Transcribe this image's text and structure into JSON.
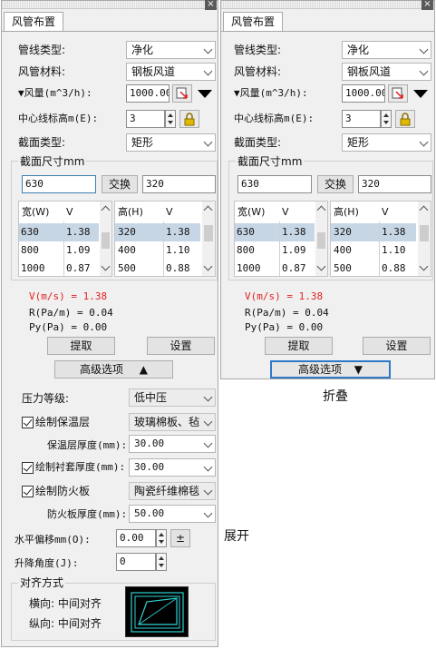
{
  "left": {
    "title_tab": "风管布置",
    "close": "×",
    "fields": {
      "duct_line_type_label": "管线类型:",
      "duct_line_type_value": "净化",
      "duct_material_label": "风管材料:",
      "duct_material_value": "钢板风道",
      "airflow_label": "▼风量(m^3/h):",
      "airflow_value": "1000.00",
      "center_elev_label": "中心线标高m(E):",
      "center_elev_value": "3",
      "section_type_label": "截面类型:",
      "section_type_value": "矩形"
    },
    "section": {
      "group_label": "截面尺寸mm",
      "width_value": "630",
      "swap_label": "交换",
      "height_value": "320",
      "w_header": "宽(W)",
      "v_header": "V",
      "h_header": "高(H)",
      "v2_header": "V",
      "w_rows": [
        {
          "w": "630",
          "v": "1.38"
        },
        {
          "w": "800",
          "v": "1.09"
        },
        {
          "w": "1000",
          "v": "0.87"
        }
      ],
      "h_rows": [
        {
          "h": "320",
          "v": "1.38"
        },
        {
          "h": "400",
          "v": "1.10"
        },
        {
          "h": "500",
          "v": "0.88"
        }
      ]
    },
    "results": {
      "velocity": "V(m/s) = 1.38",
      "resistance": "R(Pa/m) = 0.04",
      "pressure": "Py(Pa) = 0.00"
    },
    "extract_label": "提取",
    "settings_label": "设置",
    "advanced_label": "高级选项",
    "advanced_arrow": "▲",
    "pressure_level_label": "压力等级:",
    "pressure_level_value": "低中压",
    "insulation_label": "绘制保温层",
    "insulation_value": "玻璃棉板、毡",
    "insulation_thk_label": "保温层厚度(mm):",
    "insulation_thk_value": "30.00",
    "lining_label": "绘制衬套厚度(mm):",
    "lining_value": "30.00",
    "fireboard_label": "绘制防火板",
    "fireboard_value": "陶瓷纤维棉毯",
    "fireboard_thk_label": "防火板厚度(mm):",
    "fireboard_thk_value": "50.00",
    "h_offset_label": "水平偏移mm(O):",
    "h_offset_value": "0.00",
    "pm_label": "±",
    "lift_angle_label": "升降角度(J):",
    "lift_angle_value": "0",
    "align_group_label": "对齐方式",
    "align_h": "横向: 中间对齐",
    "align_v": "纵向: 中间对齐"
  },
  "right": {
    "title_tab": "风管布置",
    "close": "×",
    "fields": {
      "duct_line_type_label": "管线类型:",
      "duct_line_type_value": "净化",
      "duct_material_label": "风管材料:",
      "duct_material_value": "钢板风道",
      "airflow_label": "▼风量(m^3/h):",
      "airflow_value": "1000.00",
      "center_elev_label": "中心线标高m(E):",
      "center_elev_value": "3",
      "section_type_label": "截面类型:",
      "section_type_value": "矩形"
    },
    "section": {
      "group_label": "截面尺寸mm",
      "width_value": "630",
      "swap_label": "交换",
      "height_value": "320",
      "w_header": "宽(W)",
      "v_header": "V",
      "h_header": "高(H)",
      "v2_header": "V",
      "w_rows": [
        {
          "w": "630",
          "v": "1.38"
        },
        {
          "w": "800",
          "v": "1.09"
        },
        {
          "w": "1000",
          "v": "0.87"
        }
      ],
      "h_rows": [
        {
          "h": "320",
          "v": "1.38"
        },
        {
          "h": "400",
          "v": "1.10"
        },
        {
          "h": "500",
          "v": "0.88"
        }
      ]
    },
    "results": {
      "velocity": "V(m/s) = 1.38",
      "resistance": "R(Pa/m) = 0.04",
      "pressure": "Py(Pa) = 0.00"
    },
    "extract_label": "提取",
    "settings_label": "设置",
    "advanced_label": "高级选项",
    "advanced_arrow": "▼"
  },
  "captions": {
    "collapsed": "折叠",
    "expanded": "展开"
  },
  "colors": {
    "accent_blue": "#2f78c8",
    "velocity_red": "#e02020",
    "selected_row": "#c7d6e5",
    "preview_cyan": "#2fd3d3"
  },
  "icons": {
    "pick_icon": "pick-from-drawing-icon",
    "lock_icon": "lock-icon",
    "dropdown_icon": "dropdown-triangle-icon"
  }
}
